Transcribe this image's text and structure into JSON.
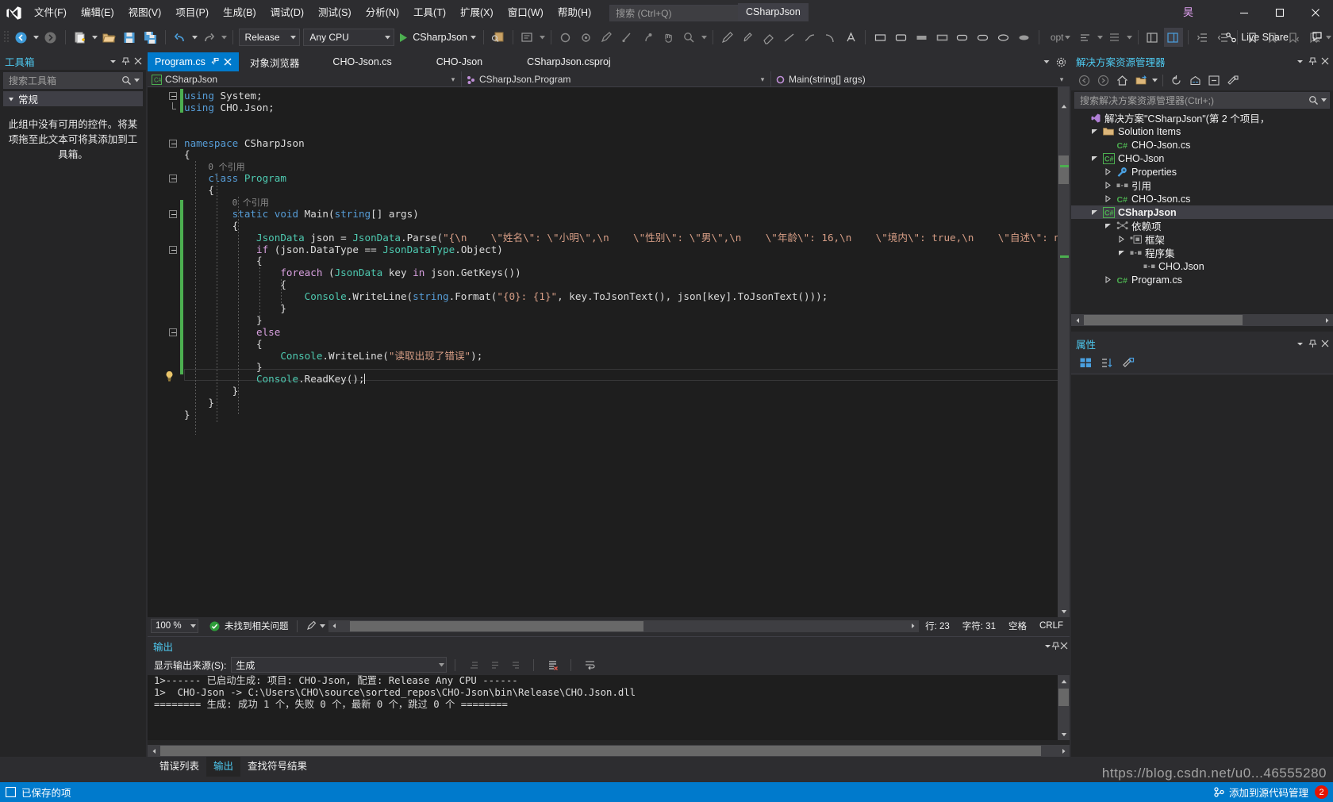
{
  "window": {
    "title": "CSharpJson",
    "user_initial": "昊",
    "minimize": "minimize-icon",
    "maximize": "maximize-icon",
    "close": "close-icon"
  },
  "menu": {
    "items": [
      {
        "label": "文件(F)",
        "name": "menu-file"
      },
      {
        "label": "编辑(E)",
        "name": "menu-edit"
      },
      {
        "label": "视图(V)",
        "name": "menu-view"
      },
      {
        "label": "项目(P)",
        "name": "menu-project"
      },
      {
        "label": "生成(B)",
        "name": "menu-build"
      },
      {
        "label": "调试(D)",
        "name": "menu-debug"
      },
      {
        "label": "测试(S)",
        "name": "menu-test"
      },
      {
        "label": "分析(N)",
        "name": "menu-analyze"
      },
      {
        "label": "工具(T)",
        "name": "menu-tools"
      },
      {
        "label": "扩展(X)",
        "name": "menu-extensions"
      },
      {
        "label": "窗口(W)",
        "name": "menu-window"
      },
      {
        "label": "帮助(H)",
        "name": "menu-help"
      }
    ],
    "search_placeholder": "搜索 (Ctrl+Q)"
  },
  "toolbar": {
    "configuration": "Release",
    "platform": "Any CPU",
    "run_label": "CSharpJson",
    "live_share": "Live Share",
    "opt_label": "opt"
  },
  "toolbox": {
    "title": "工具箱",
    "search_placeholder": "搜索工具箱",
    "group": "常规",
    "empty_message": "此组中没有可用的控件。将某项拖至此文本可将其添加到工具箱。"
  },
  "tabs": [
    {
      "label": "Program.cs",
      "active": true
    },
    {
      "label": "对象浏览器",
      "active": false
    },
    {
      "label": "CHO-Json.cs",
      "active": false
    },
    {
      "label": "CHO-Json",
      "active": false
    },
    {
      "label": "CSharpJson.csproj",
      "active": false
    }
  ],
  "navbar": {
    "project": "CSharpJson",
    "type": "CSharpJson.Program",
    "member": "Main(string[] args)"
  },
  "code": {
    "lines": [
      {
        "indent": 0,
        "fold": "minus",
        "parts": [
          {
            "t": "using ",
            "c": "kw"
          },
          {
            "t": "System;",
            "c": "id"
          }
        ]
      },
      {
        "indent": 0,
        "fold": "end",
        "parts": [
          {
            "t": "using ",
            "c": "kw"
          },
          {
            "t": "CHO.Json;",
            "c": "id"
          }
        ]
      },
      {
        "indent": 0,
        "fold": "",
        "parts": []
      },
      {
        "indent": 0,
        "fold": "",
        "parts": []
      },
      {
        "indent": 0,
        "fold": "minus",
        "parts": [
          {
            "t": "namespace ",
            "c": "kw"
          },
          {
            "t": "CSharpJson",
            "c": "id"
          }
        ]
      },
      {
        "indent": 0,
        "fold": "",
        "parts": [
          {
            "t": "{",
            "c": "id"
          }
        ]
      },
      {
        "indent": 1,
        "fold": "",
        "parts": [
          {
            "t": "0 个引用",
            "c": "ref"
          }
        ]
      },
      {
        "indent": 1,
        "fold": "minus",
        "parts": [
          {
            "t": "class ",
            "c": "kw"
          },
          {
            "t": "Program",
            "c": "ty"
          }
        ]
      },
      {
        "indent": 1,
        "fold": "",
        "parts": [
          {
            "t": "{",
            "c": "id"
          }
        ]
      },
      {
        "indent": 2,
        "fold": "",
        "parts": [
          {
            "t": "0 个引用",
            "c": "ref"
          }
        ]
      },
      {
        "indent": 2,
        "fold": "minus",
        "parts": [
          {
            "t": "static ",
            "c": "kw"
          },
          {
            "t": "void ",
            "c": "kw"
          },
          {
            "t": "Main",
            "c": "id"
          },
          {
            "t": "(",
            "c": "id"
          },
          {
            "t": "string",
            "c": "kw"
          },
          {
            "t": "[] ",
            "c": "id"
          },
          {
            "t": "args",
            "c": "id"
          },
          {
            "t": ")",
            "c": "id"
          }
        ]
      },
      {
        "indent": 2,
        "fold": "",
        "parts": [
          {
            "t": "{",
            "c": "id"
          }
        ]
      },
      {
        "indent": 3,
        "fold": "",
        "parts": [
          {
            "t": "JsonData",
            "c": "ty"
          },
          {
            "t": " json = ",
            "c": "id"
          },
          {
            "t": "JsonData",
            "c": "ty"
          },
          {
            "t": ".Parse(",
            "c": "id"
          },
          {
            "t": "\"{\\n    \\\"姓名\\\": \\\"小明\\\",\\n    \\\"性别\\\": \\\"男\\\",\\n    \\\"年龄\\\": 16,\\n    \\\"境内\\\": true,\\n    \\\"自述\\\": null,\\n    \\\"学习",
            "c": "st"
          }
        ]
      },
      {
        "indent": 3,
        "fold": "minus",
        "parts": [
          {
            "t": "if",
            "c": "kwc"
          },
          {
            "t": " (json.DataType == ",
            "c": "id"
          },
          {
            "t": "JsonDataType",
            "c": "ty"
          },
          {
            "t": ".Object)",
            "c": "id"
          }
        ]
      },
      {
        "indent": 3,
        "fold": "",
        "parts": [
          {
            "t": "{",
            "c": "id"
          }
        ]
      },
      {
        "indent": 4,
        "fold": "",
        "parts": [
          {
            "t": "foreach",
            "c": "kwc"
          },
          {
            "t": " (",
            "c": "id"
          },
          {
            "t": "JsonData",
            "c": "ty"
          },
          {
            "t": " key ",
            "c": "id"
          },
          {
            "t": "in",
            "c": "kwc"
          },
          {
            "t": " json.GetKeys())",
            "c": "id"
          }
        ]
      },
      {
        "indent": 4,
        "fold": "",
        "parts": [
          {
            "t": "{",
            "c": "id"
          }
        ]
      },
      {
        "indent": 5,
        "fold": "",
        "parts": [
          {
            "t": "Console",
            "c": "ty"
          },
          {
            "t": ".WriteLine(",
            "c": "id"
          },
          {
            "t": "string",
            "c": "kw"
          },
          {
            "t": ".Format(",
            "c": "id"
          },
          {
            "t": "\"{0}: {1}\"",
            "c": "st"
          },
          {
            "t": ", key.ToJsonText(), json[key].ToJsonText()));",
            "c": "id"
          }
        ]
      },
      {
        "indent": 4,
        "fold": "",
        "parts": [
          {
            "t": "}",
            "c": "id"
          }
        ]
      },
      {
        "indent": 3,
        "fold": "",
        "parts": [
          {
            "t": "}",
            "c": "id"
          }
        ]
      },
      {
        "indent": 3,
        "fold": "minus",
        "parts": [
          {
            "t": "else",
            "c": "kwc"
          }
        ]
      },
      {
        "indent": 3,
        "fold": "",
        "parts": [
          {
            "t": "{",
            "c": "id"
          }
        ]
      },
      {
        "indent": 4,
        "fold": "",
        "parts": [
          {
            "t": "Console",
            "c": "ty"
          },
          {
            "t": ".WriteLine(",
            "c": "id"
          },
          {
            "t": "\"读取出现了错误\"",
            "c": "st"
          },
          {
            "t": ");",
            "c": "id"
          }
        ]
      },
      {
        "indent": 3,
        "fold": "",
        "parts": [
          {
            "t": "}",
            "c": "id"
          }
        ]
      },
      {
        "indent": 3,
        "fold": "",
        "current": true,
        "parts": [
          {
            "t": "Console",
            "c": "ty"
          },
          {
            "t": ".ReadKey();",
            "c": "id"
          }
        ]
      },
      {
        "indent": 2,
        "fold": "",
        "parts": [
          {
            "t": "}",
            "c": "id"
          }
        ]
      },
      {
        "indent": 1,
        "fold": "",
        "parts": [
          {
            "t": "}",
            "c": "id"
          }
        ]
      },
      {
        "indent": 0,
        "fold": "",
        "parts": [
          {
            "t": "}",
            "c": "id"
          }
        ]
      }
    ]
  },
  "editor_status": {
    "zoom": "100 %",
    "issues": "未找到相关问题",
    "line_label": "行: 23",
    "col_label": "字符: 31",
    "spaces_label": "空格",
    "eol_label": "CRLF"
  },
  "output": {
    "title": "输出",
    "source_label": "显示输出来源(S):",
    "source_value": "生成",
    "lines": [
      "1>------ 已启动生成: 项目: CHO-Json, 配置: Release Any CPU ------",
      "1>  CHO-Json -> C:\\Users\\CHO\\source\\sorted_repos\\CHO-Json\\bin\\Release\\CHO.Json.dll",
      "======== 生成: 成功 1 个，失败 0 个，最新 0 个，跳过 0 个 ========"
    ]
  },
  "bottom_tabs": [
    {
      "label": "错误列表",
      "active": false
    },
    {
      "label": "输出",
      "active": true
    },
    {
      "label": "查找符号结果",
      "active": false
    }
  ],
  "solution_explorer": {
    "title": "解决方案资源管理器",
    "search_placeholder": "搜索解决方案资源管理器(Ctrl+;)",
    "tree": [
      {
        "depth": 0,
        "expander": "none",
        "icon": "solution-icon",
        "label": "解决方案\"CSharpJson\"(第 2 个项目，",
        "selected": false,
        "bold": false
      },
      {
        "depth": 1,
        "expander": "open",
        "icon": "folder-icon",
        "label": "Solution Items",
        "selected": false,
        "bold": false
      },
      {
        "depth": 2,
        "expander": "none",
        "icon": "csharp-file-icon",
        "label": "CHO-Json.cs",
        "selected": false,
        "bold": false
      },
      {
        "depth": 1,
        "expander": "open",
        "icon": "project-icon",
        "label": "CHO-Json",
        "selected": false,
        "bold": false
      },
      {
        "depth": 2,
        "expander": "closed",
        "icon": "wrench-icon",
        "label": "Properties",
        "selected": false,
        "bold": false
      },
      {
        "depth": 2,
        "expander": "closed",
        "icon": "references-icon",
        "label": "引用",
        "selected": false,
        "bold": false
      },
      {
        "depth": 2,
        "expander": "closed",
        "icon": "csharp-file-icon",
        "label": "CHO-Json.cs",
        "selected": false,
        "bold": false
      },
      {
        "depth": 1,
        "expander": "open",
        "icon": "project-icon",
        "label": "CSharpJson",
        "selected": true,
        "bold": true
      },
      {
        "depth": 2,
        "expander": "open",
        "icon": "dependencies-icon",
        "label": "依赖项",
        "selected": false,
        "bold": false
      },
      {
        "depth": 3,
        "expander": "closed",
        "icon": "framework-icon",
        "label": "框架",
        "selected": false,
        "bold": false
      },
      {
        "depth": 3,
        "expander": "open",
        "icon": "assembly-icon",
        "label": "程序集",
        "selected": false,
        "bold": false
      },
      {
        "depth": 4,
        "expander": "none",
        "icon": "assembly-icon",
        "label": "CHO.Json",
        "selected": false,
        "bold": false
      },
      {
        "depth": 2,
        "expander": "closed",
        "icon": "csharp-file-icon",
        "label": "Program.cs",
        "selected": false,
        "bold": false
      }
    ]
  },
  "properties": {
    "title": "属性"
  },
  "statusbar": {
    "saved_label": "已保存的项",
    "source_control": "添加到源代码管理",
    "error_count": "2"
  },
  "watermark": "https://blog.csdn.net/u0...46555280",
  "colors": {
    "accent": "#007acc",
    "panel": "#252526",
    "chrome": "#2d2d30",
    "editor_bg": "#1e1e1e",
    "keyword": "#569cd6",
    "type": "#4ec9b0",
    "string": "#d69d85",
    "control_keyword": "#d8a0df",
    "error_red": "#e51400"
  }
}
